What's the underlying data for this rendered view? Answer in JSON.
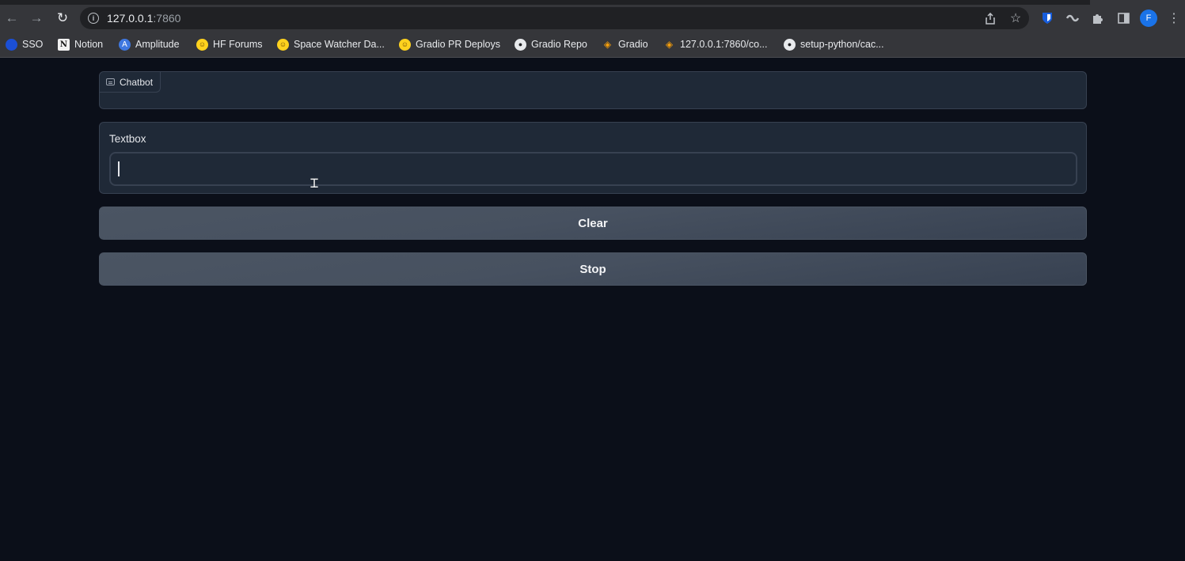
{
  "browser": {
    "url_host": "127.0.0.1",
    "url_port": ":7860",
    "profile_initial": "F"
  },
  "bookmarks": [
    {
      "label": "SSO",
      "icon": "sso-icon"
    },
    {
      "label": "Notion",
      "icon": "notion-icon",
      "glyph": "N"
    },
    {
      "label": "Amplitude",
      "icon": "amplitude-icon",
      "glyph": "A"
    },
    {
      "label": "HF Forums",
      "icon": "huggingface-icon",
      "glyph": "☺"
    },
    {
      "label": "Space Watcher Da...",
      "icon": "huggingface-icon",
      "glyph": "☺"
    },
    {
      "label": "Gradio PR Deploys",
      "icon": "huggingface-icon",
      "glyph": "☺"
    },
    {
      "label": "Gradio Repo",
      "icon": "github-icon",
      "glyph": "●"
    },
    {
      "label": "Gradio",
      "icon": "gradio-icon",
      "glyph": "◈"
    },
    {
      "label": "127.0.0.1:7860/co...",
      "icon": "gradio-icon",
      "glyph": "◈"
    },
    {
      "label": "setup-python/cac...",
      "icon": "github-icon",
      "glyph": "●"
    }
  ],
  "app": {
    "chatbot_label": "Chatbot",
    "textbox_label": "Textbox",
    "textbox_value": "",
    "clear_label": "Clear",
    "stop_label": "Stop"
  },
  "colors": {
    "page_bg": "#0b0f19",
    "panel_bg": "#1f2937",
    "border": "#374151",
    "button_bg": "#4b5563"
  }
}
